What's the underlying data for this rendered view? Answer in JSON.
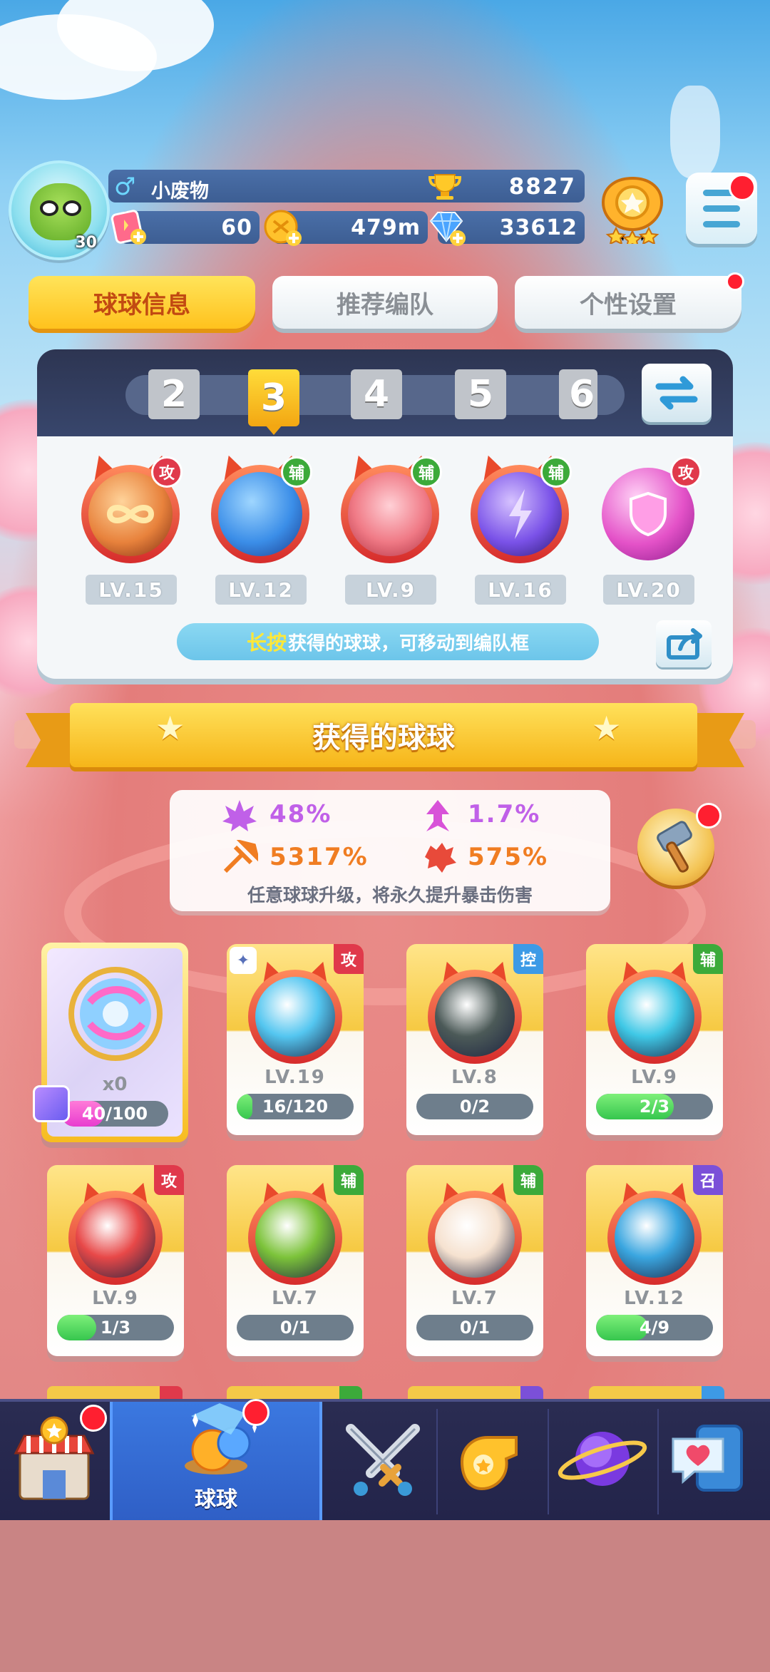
{
  "player": {
    "name": "小废物",
    "gender_icon": "♂",
    "level": "30",
    "trophies": "8827",
    "energy": "60",
    "gold": "479m",
    "gems": "33612"
  },
  "tabs": [
    {
      "label": "球球信息",
      "active": true
    },
    {
      "label": "推荐编队",
      "active": false
    },
    {
      "label": "个性设置",
      "active": false
    }
  ],
  "team": {
    "slots": [
      "2",
      "3",
      "4",
      "5",
      "6"
    ],
    "active_slot": "3",
    "balls": [
      {
        "name": "infinity-ball",
        "type": "攻",
        "level": "LV.15",
        "core": "#e8823c"
      },
      {
        "name": "hexagon-ball",
        "type": "辅",
        "level": "LV.12",
        "core": "#3b8ee8"
      },
      {
        "name": "muscle-ball",
        "type": "辅",
        "level": "LV.9",
        "core": "#f07a86"
      },
      {
        "name": "lightning-ball",
        "type": "辅",
        "level": "LV.16",
        "core": "#7a52e8"
      },
      {
        "name": "shield-ball",
        "type": "攻",
        "level": "LV.20",
        "core": "#e452c8"
      }
    ],
    "hint_highlight": "长按",
    "hint_text": "获得的球球，可移动到编队框"
  },
  "banner": {
    "title": "获得的球球"
  },
  "crit": {
    "rate1": "48%",
    "rate2": "1.7%",
    "damage1": "5317%",
    "damage2": "575%",
    "desc": "任意球球升级，将永久提升暴击伤害",
    "colors": {
      "purple": "#c060e8",
      "orange": "#f07d22"
    }
  },
  "special_card": {
    "count": "x0",
    "progress": "40/100",
    "fraction": 0.4
  },
  "cards": [
    {
      "name": "ice-pin-ball",
      "type": "攻",
      "level": "LV.19",
      "progress": "16/120",
      "fraction": 0.1333,
      "core": "#54c6f0",
      "badge": "#e0394b",
      "pinned": true
    },
    {
      "name": "ghost-mask-ball",
      "type": "控",
      "level": "LV.8",
      "progress": "0/2",
      "fraction": 0,
      "core": "#4c5a58",
      "badge": "#3d9ae6",
      "pinned": false
    },
    {
      "name": "swirl-ball",
      "type": "辅",
      "level": "LV.9",
      "progress": "2/3",
      "fraction": 0.6667,
      "core": "#3fc8e6",
      "badge": "#3caa3a",
      "pinned": false
    },
    {
      "name": "plasma-ball",
      "type": "攻",
      "level": "LV.9",
      "progress": "1/3",
      "fraction": 0.3333,
      "core": "#e84848",
      "badge": "#e0394b",
      "pinned": false
    },
    {
      "name": "goblin-ball",
      "type": "辅",
      "level": "LV.7",
      "progress": "0/1",
      "fraction": 0,
      "core": "#7cc33a",
      "badge": "#3caa3a",
      "pinned": false
    },
    {
      "name": "sheep-ball",
      "type": "辅",
      "level": "LV.7",
      "progress": "0/1",
      "fraction": 0,
      "core": "#f6e2d0",
      "badge": "#3caa3a",
      "pinned": false
    },
    {
      "name": "fish-ball",
      "type": "召",
      "level": "LV.12",
      "progress": "4/9",
      "fraction": 0.4444,
      "core": "#3aa6e0",
      "badge": "#7b50d8",
      "pinned": false
    }
  ],
  "nav": {
    "items": [
      {
        "name": "shop",
        "icon": "shop-icon"
      },
      {
        "name": "balls",
        "icon": "crystal-ball-icon",
        "label": "球球",
        "active": true
      },
      {
        "name": "battle",
        "icon": "crossed-swords-icon"
      },
      {
        "name": "whistle",
        "icon": "whistle-icon"
      },
      {
        "name": "planet",
        "icon": "planet-icon"
      },
      {
        "name": "social",
        "icon": "heart-chat-icon"
      }
    ]
  }
}
